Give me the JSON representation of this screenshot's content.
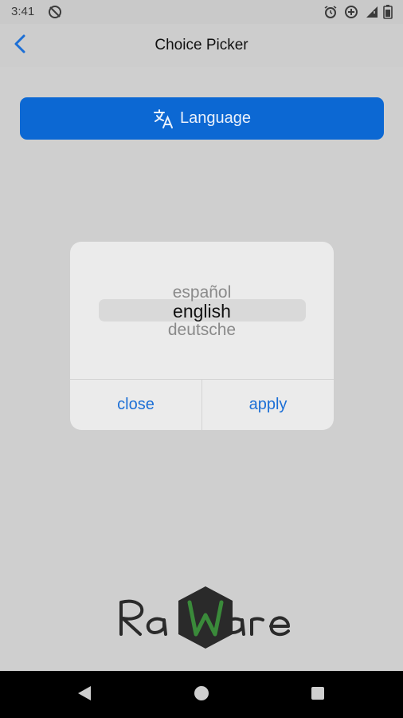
{
  "status_bar": {
    "time": "3:41",
    "icons": [
      "sync-off-icon",
      "alarm-icon",
      "data-saver-icon",
      "signal-icon",
      "battery-icon"
    ]
  },
  "app_bar": {
    "title": "Choice Picker",
    "back_icon": "chevron-left-icon",
    "accent_color": "#1c6fd6"
  },
  "language_button": {
    "label": "Language",
    "icon": "translate-icon",
    "color": "#0c68d3"
  },
  "picker_dialog": {
    "options": [
      "español",
      "english",
      "deutsche"
    ],
    "selected": "english",
    "close_label": "close",
    "apply_label": "apply"
  },
  "logo": {
    "text": "RaWare",
    "accent_color": "#3a8a3a"
  },
  "nav_bar": {
    "buttons": [
      "back-triangle-icon",
      "home-circle-icon",
      "recents-square-icon"
    ]
  }
}
